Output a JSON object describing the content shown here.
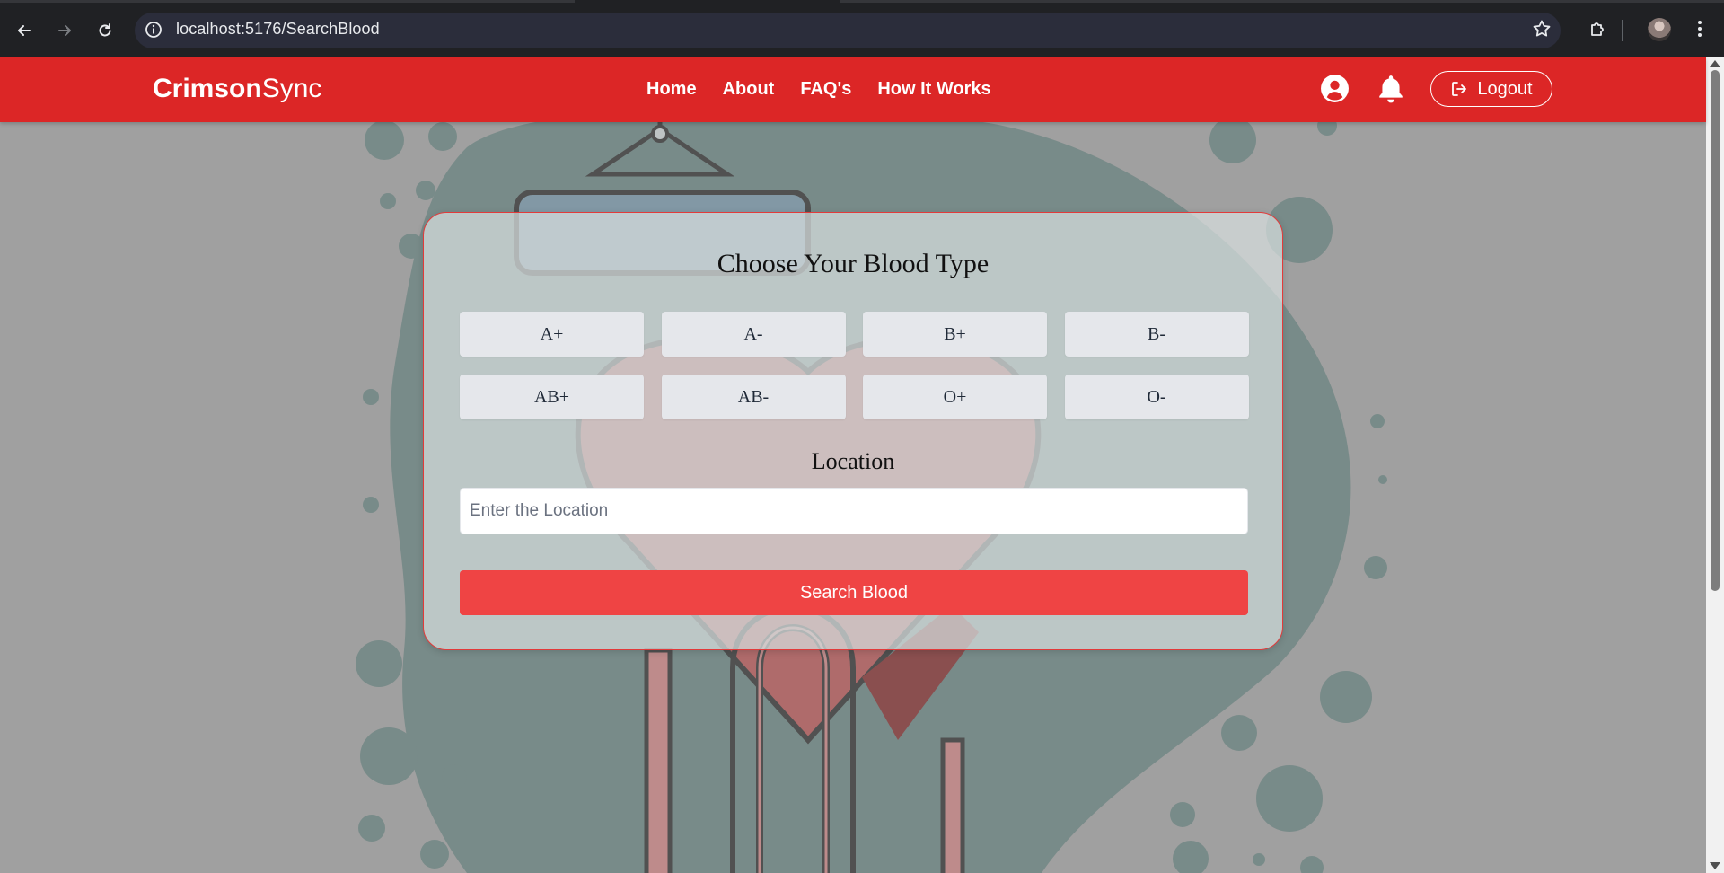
{
  "browser": {
    "url": "localhost:5176/SearchBlood"
  },
  "navbar": {
    "brand_bold": "Crimson",
    "brand_light": "Sync",
    "links": [
      "Home",
      "About",
      "FAQ's",
      "How It Works"
    ],
    "logout_label": "Logout",
    "accent_color": "#dc2626"
  },
  "card": {
    "title": "Choose Your Blood Type",
    "blood_types": [
      "A+",
      "A-",
      "B+",
      "B-",
      "AB+",
      "AB-",
      "O+",
      "O-"
    ],
    "location_label": "Location",
    "location_placeholder": "Enter the Location",
    "location_value": "",
    "search_button_label": "Search Blood",
    "search_button_color": "#ef4444"
  },
  "icons": [
    "back-arrow-icon",
    "forward-arrow-icon",
    "reload-icon",
    "site-info-icon",
    "bookmark-star-icon",
    "extensions-icon",
    "browser-menu-icon",
    "user-circle-icon",
    "bell-icon",
    "logout-icon"
  ]
}
